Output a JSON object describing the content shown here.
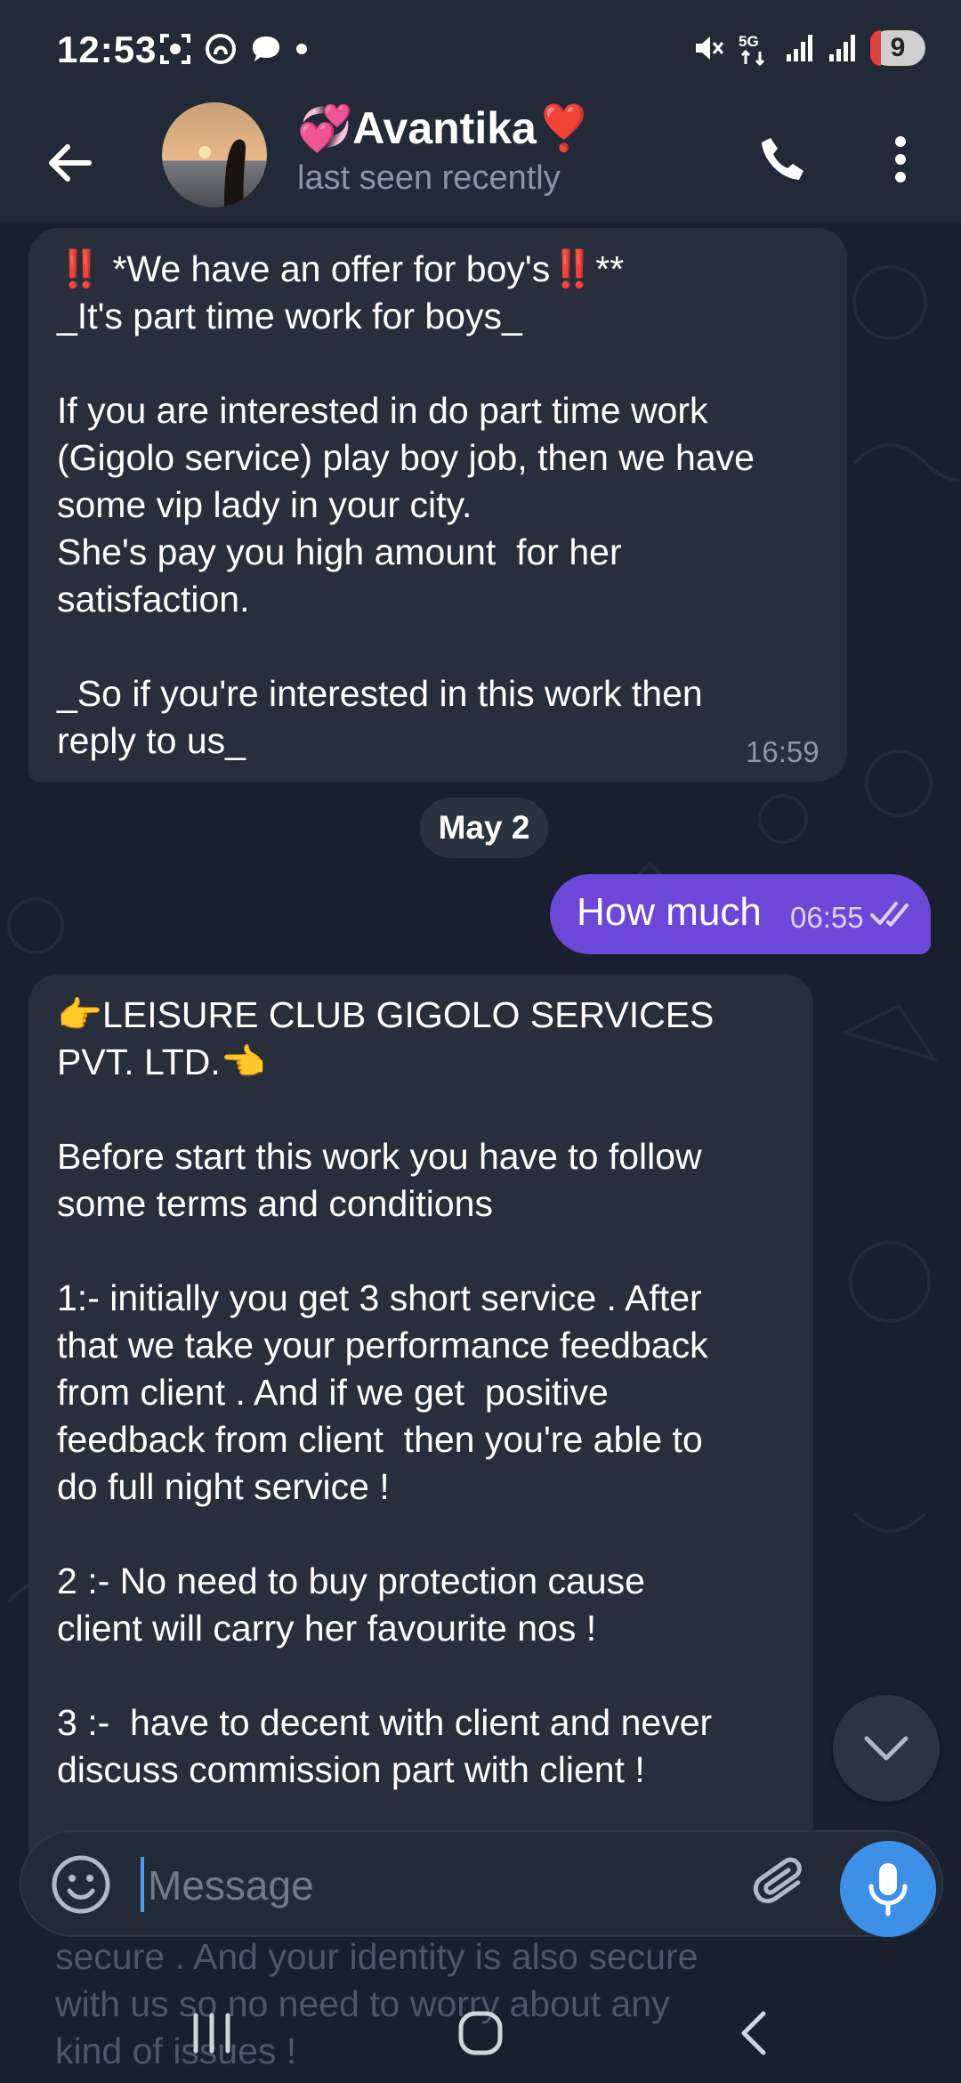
{
  "status_bar": {
    "time": "12:53",
    "network": "5G",
    "battery": "9"
  },
  "header": {
    "contact_name": "💞Avantika❣️",
    "contact_status": "last seen recently"
  },
  "messages": [
    {
      "direction": "incoming",
      "text": "‼️ *We have an offer for boy's‼️**\n_It's part time work for boys_\n\nIf you are interested in do part time work\n(Gigolo service) play boy job, then we have\nsome vip lady in your city.\nShe's pay you high amount  for her\nsatisfaction.\n\n_So if you're interested in this work then\nreply to us_",
      "time": "16:59"
    },
    {
      "direction": "outgoing",
      "text": "How much",
      "time": "06:55",
      "status": "read"
    },
    {
      "direction": "incoming",
      "text": "👉LEISURE CLUB GIGOLO SERVICES\nPVT. LTD.👈\n\nBefore start this work you have to follow\nsome terms and conditions\n\n1:- initially you get 3 short service . After\nthat we take your performance feedback\nfrom client . And if we get  positive\nfeedback from client  then you're able to\ndo full night service !\n\n2 :- No need to buy protection cause\nclient will carry her favourite nos !\n\n3 :-  have to decent with client and never\ndiscuss commission part with client !"
    }
  ],
  "date_separator": "May 2",
  "hidden_text": "secure . And your identity is also secure\nwith us so no need to worry about any\nkind of issues !",
  "composer": {
    "placeholder": "Message"
  },
  "icons": {
    "back": "arrow-left-icon",
    "call": "phone-icon",
    "menu": "more-vertical-icon",
    "emoji": "smiley-icon",
    "attach": "paperclip-icon",
    "mic": "microphone-icon",
    "scroll": "chevron-down-icon"
  },
  "colors": {
    "background": "#17202c",
    "header": "#222a37",
    "incoming_bubble": "#272f3c",
    "outgoing_bubble": "#6c48d9",
    "accent": "#3e8fe8"
  }
}
